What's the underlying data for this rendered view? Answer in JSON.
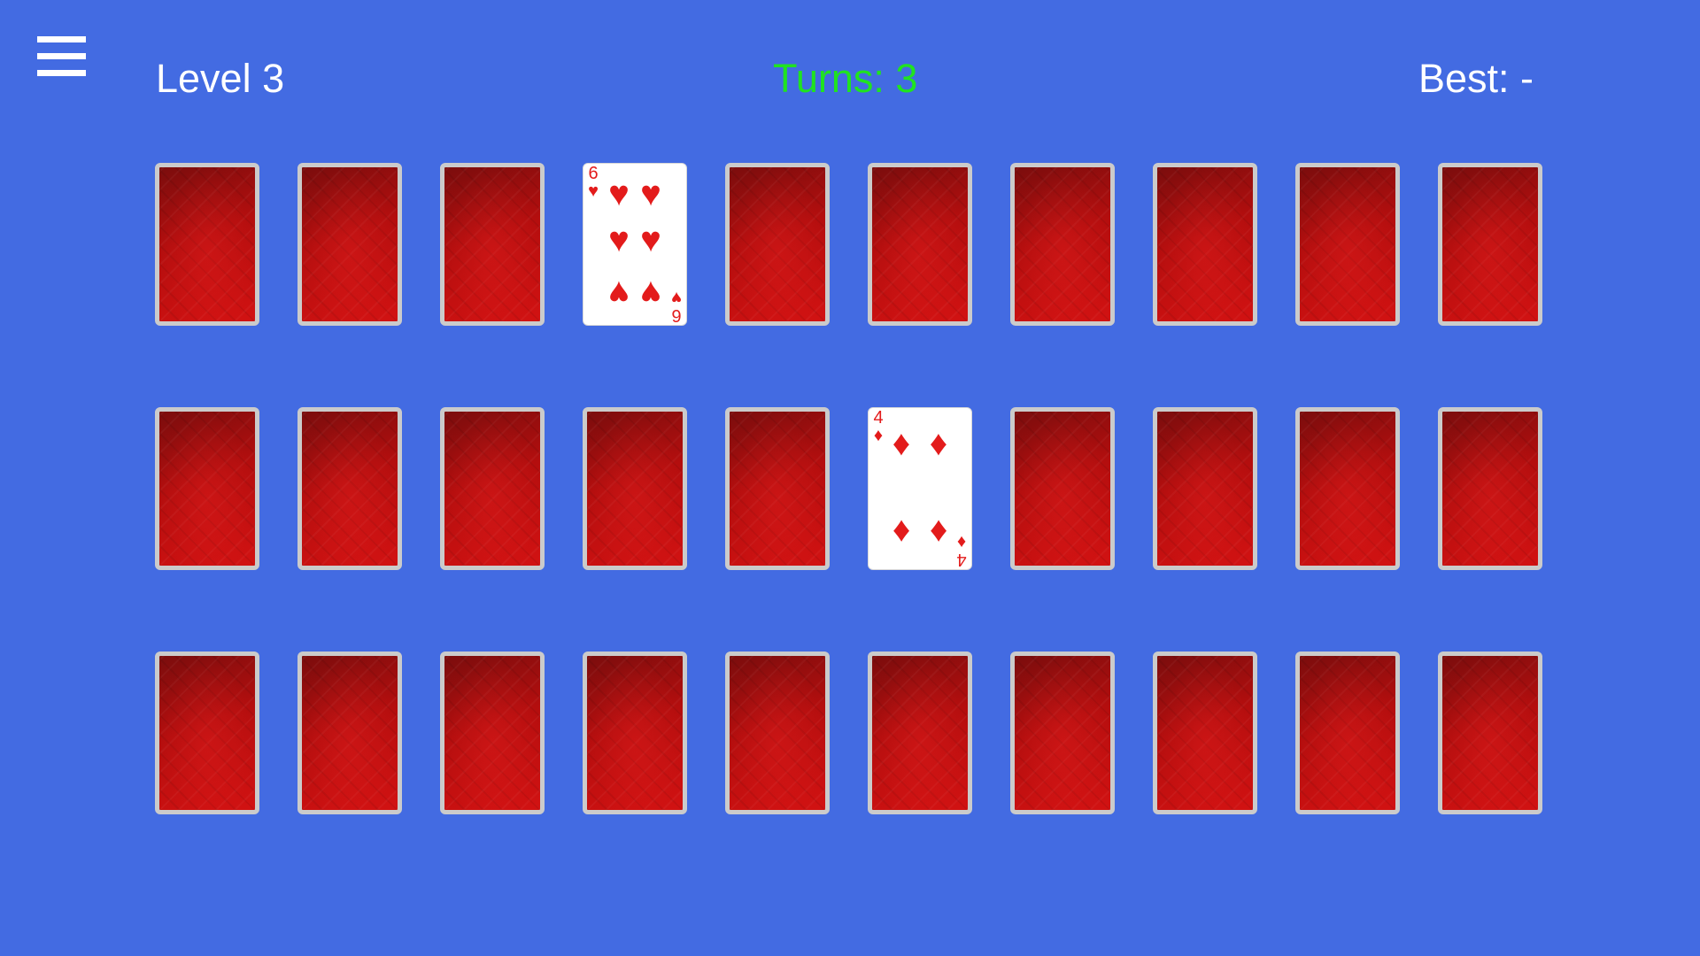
{
  "hud": {
    "level_text": "Level 3",
    "turns_text": "Turns: 3",
    "best_text": "Best: -"
  },
  "colors": {
    "background": "#436be2",
    "turns_text": "#20e320",
    "card_back": "#b40e0e",
    "card_border": "#cbcbcb",
    "suit_red": "#e31b1b"
  },
  "grid": {
    "rows": 3,
    "columns": 10
  },
  "face_up_cards": [
    {
      "row": 1,
      "col": 4,
      "rank": "6",
      "suit": "hearts",
      "suit_symbol": "♥"
    },
    {
      "row": 2,
      "col": 6,
      "rank": "4",
      "suit": "diamonds",
      "suit_symbol": "♦"
    }
  ],
  "icons": {
    "menu": "hamburger-menu-icon"
  }
}
